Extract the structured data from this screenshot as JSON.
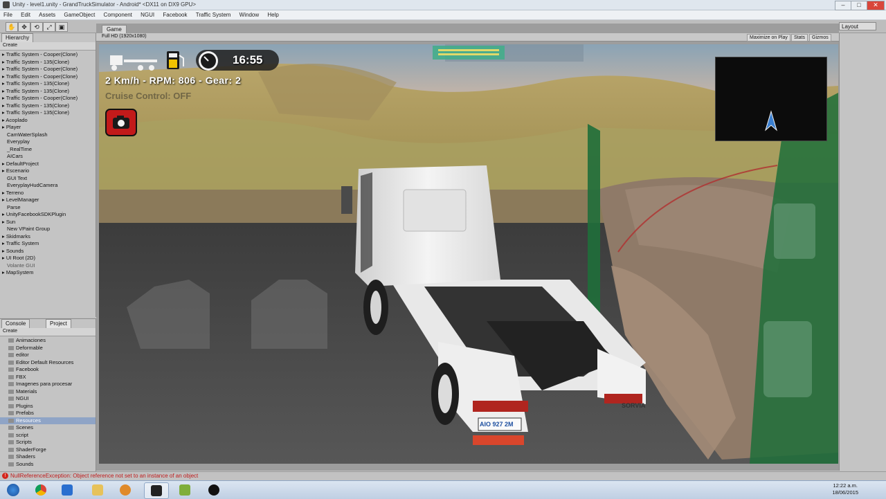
{
  "window": {
    "title": "Unity - level1.unity - GrandTruckSimulator - Android* <DX11 on DX9 GPU>",
    "minimize": "–",
    "maximize": "□",
    "close": "✕"
  },
  "menu": [
    "File",
    "Edit",
    "Assets",
    "GameObject",
    "Component",
    "NGUI",
    "Facebook",
    "Traffic System",
    "Window",
    "Help"
  ],
  "toolbar": {
    "tools": [
      "✋",
      "✥",
      "⟲",
      "⤢",
      "▣"
    ],
    "layout_label": "Layout"
  },
  "hierarchy": {
    "tab": "Hierarchy",
    "create": "Create",
    "items": [
      {
        "label": "▸ Traffic System - Cooper(Clone)",
        "level": "root"
      },
      {
        "label": "▸ Traffic System - 135(Clone)",
        "level": "root"
      },
      {
        "label": "▸ Traffic System - Cooper(Clone)",
        "level": "root"
      },
      {
        "label": "▸ Traffic System - Cooper(Clone)",
        "level": "root"
      },
      {
        "label": "▸ Traffic System - 135(Clone)",
        "level": "root"
      },
      {
        "label": "▸ Traffic System - 135(Clone)",
        "level": "root"
      },
      {
        "label": "▸ Traffic System - Cooper(Clone)",
        "level": "root"
      },
      {
        "label": "▸ Traffic System - 135(Clone)",
        "level": "root"
      },
      {
        "label": "▸ Traffic System - 135(Clone)",
        "level": "root"
      },
      {
        "label": "▸ Acoplado",
        "level": "root"
      },
      {
        "label": "▸ Player",
        "level": "root"
      },
      {
        "label": "CamWaterSplash",
        "level": "indent"
      },
      {
        "label": "Everyplay",
        "level": "indent"
      },
      {
        "label": "_RealTime",
        "level": "indent"
      },
      {
        "label": "AICars",
        "level": "indent"
      },
      {
        "label": "▸ DefaultProject",
        "level": "root"
      },
      {
        "label": "▸ Escenario",
        "level": "root"
      },
      {
        "label": "GUI Text",
        "level": "indent"
      },
      {
        "label": "EveryplayHudCamera",
        "level": "indent"
      },
      {
        "label": "▸ Terreno",
        "level": "root"
      },
      {
        "label": "▸ LevelManager",
        "level": "root"
      },
      {
        "label": "Parse",
        "level": "indent"
      },
      {
        "label": "▸ UnityFacebookSDKPlugin",
        "level": "root"
      },
      {
        "label": "▸ Sun",
        "level": "root"
      },
      {
        "label": "New VPaint Group",
        "level": "indent"
      },
      {
        "label": "▸ Skidmarks",
        "level": "root"
      },
      {
        "label": "▸ Traffic System",
        "level": "root"
      },
      {
        "label": "▸ Sounds",
        "level": "root"
      },
      {
        "label": "▸ UI Root (2D)",
        "level": "root"
      },
      {
        "label": "Volante GUI",
        "level": "dim"
      },
      {
        "label": "▸ MapSystem",
        "level": "root"
      }
    ]
  },
  "project": {
    "tabs": [
      "Console",
      "Project"
    ],
    "create": "Create",
    "items": [
      {
        "label": "Animaciones",
        "selected": false
      },
      {
        "label": "Deformable",
        "selected": false
      },
      {
        "label": "editor",
        "selected": false
      },
      {
        "label": "Editor Default Resources",
        "selected": false
      },
      {
        "label": "Facebook",
        "selected": false
      },
      {
        "label": "FBX",
        "selected": false
      },
      {
        "label": "Imagenes para procesar",
        "selected": false
      },
      {
        "label": "Materials",
        "selected": false
      },
      {
        "label": "NGUI",
        "selected": false
      },
      {
        "label": "Plugins",
        "selected": false
      },
      {
        "label": "Prefabs",
        "selected": false
      },
      {
        "label": "Resources",
        "selected": true
      },
      {
        "label": "Scenes",
        "selected": false
      },
      {
        "label": "script",
        "selected": false
      },
      {
        "label": "Scripts",
        "selected": false
      },
      {
        "label": "ShaderForge",
        "selected": false
      },
      {
        "label": "Shaders",
        "selected": false
      },
      {
        "label": "Sounds",
        "selected": false
      }
    ]
  },
  "game": {
    "tab": "Game",
    "aspect": "Full HD (1920x1080)",
    "maximize_on_play": "Maximize on Play",
    "stats": "Stats",
    "gizmos": "Gizmos",
    "hud": {
      "clock": "16:55",
      "readout": "2 Km/h - RPM: 806 - Gear: 2",
      "cruise": "Cruise Control: OFF",
      "plate": "AIO 927 2M",
      "brand": "SORVIA"
    },
    "icons": {
      "truck": "truck-trailer-icon",
      "fuel": "fuel-pump-icon",
      "gauge": "speedometer-icon",
      "camera": "camera-icon",
      "minimap_arrow": "navigation-arrow-icon"
    },
    "colors": {
      "hud_yellow": "#f2c300",
      "camera_red": "#c21a1a",
      "pedal_green": "#1f6e3a"
    }
  },
  "status": {
    "message": "NullReferenceException: Object reference not set to an instance of an object"
  },
  "taskbar": {
    "time": "12:22 a.m.",
    "date": "18/06/2015"
  }
}
